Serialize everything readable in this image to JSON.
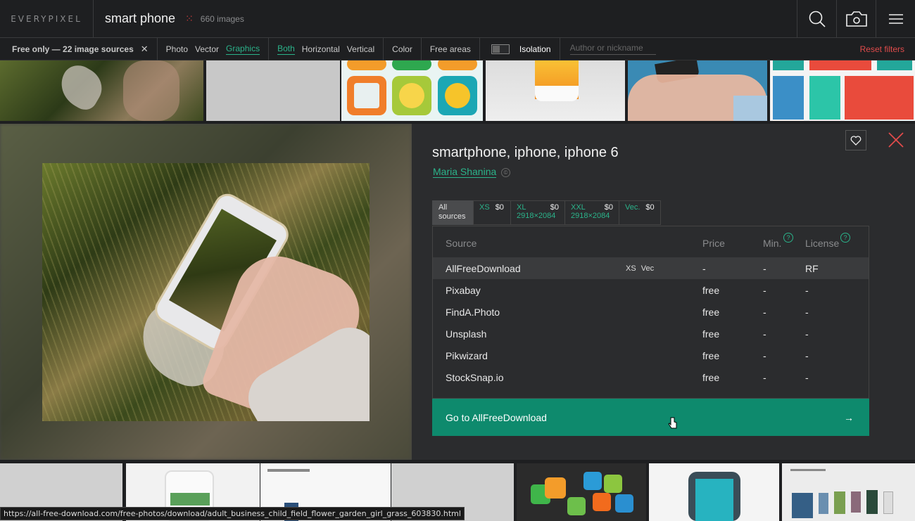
{
  "header": {
    "logo": "EVERYPIXEL",
    "query": "smart phone",
    "count": "660 images"
  },
  "filters": {
    "free_only": "Free only — 22 image sources",
    "types": [
      "Photo",
      "Vector",
      "Graphics"
    ],
    "orientation": [
      "Both",
      "Horizontal",
      "Vertical"
    ],
    "color": "Color",
    "free_areas": "Free areas",
    "isolation": "Isolation",
    "author_placeholder": "Author or nickname",
    "reset": "Reset filters"
  },
  "detail": {
    "title": "smartphone, iphone, iphone 6",
    "author": "Maria Shanina",
    "tabs": [
      {
        "label": "All\nsources",
        "price": ""
      },
      {
        "label": "XS",
        "price": "$0"
      },
      {
        "label": "XL",
        "sub": "2918×2084",
        "price": "$0"
      },
      {
        "label": "XXL",
        "sub": "2918×2084",
        "price": "$0"
      },
      {
        "label": "Vec.",
        "price": "$0"
      }
    ],
    "columns": {
      "source": "Source",
      "price": "Price",
      "min": "Min.",
      "license": "License"
    },
    "rows": [
      {
        "source": "AllFreeDownload",
        "tags": "XS Vec",
        "price": "-",
        "min": "-",
        "license": "RF"
      },
      {
        "source": "Pixabay",
        "tags": "",
        "price": "free",
        "min": "-",
        "license": "-"
      },
      {
        "source": "FindA.Photo",
        "tags": "",
        "price": "free",
        "min": "-",
        "license": "-"
      },
      {
        "source": "Unsplash",
        "tags": "",
        "price": "free",
        "min": "-",
        "license": "-"
      },
      {
        "source": "Pikwizard",
        "tags": "",
        "price": "free",
        "min": "-",
        "license": "-"
      },
      {
        "source": "StockSnap.io",
        "tags": "",
        "price": "free",
        "min": "-",
        "license": "-"
      }
    ],
    "goto": "Go to AllFreeDownload"
  },
  "status_url": "https://all-free-download.com/free-photos/download/adult_business_child_field_flower_garden_girl_grass_603830.html",
  "colors": {
    "accent": "#2bb38a",
    "button": "#0e8a6d",
    "danger": "#e04b4b"
  }
}
